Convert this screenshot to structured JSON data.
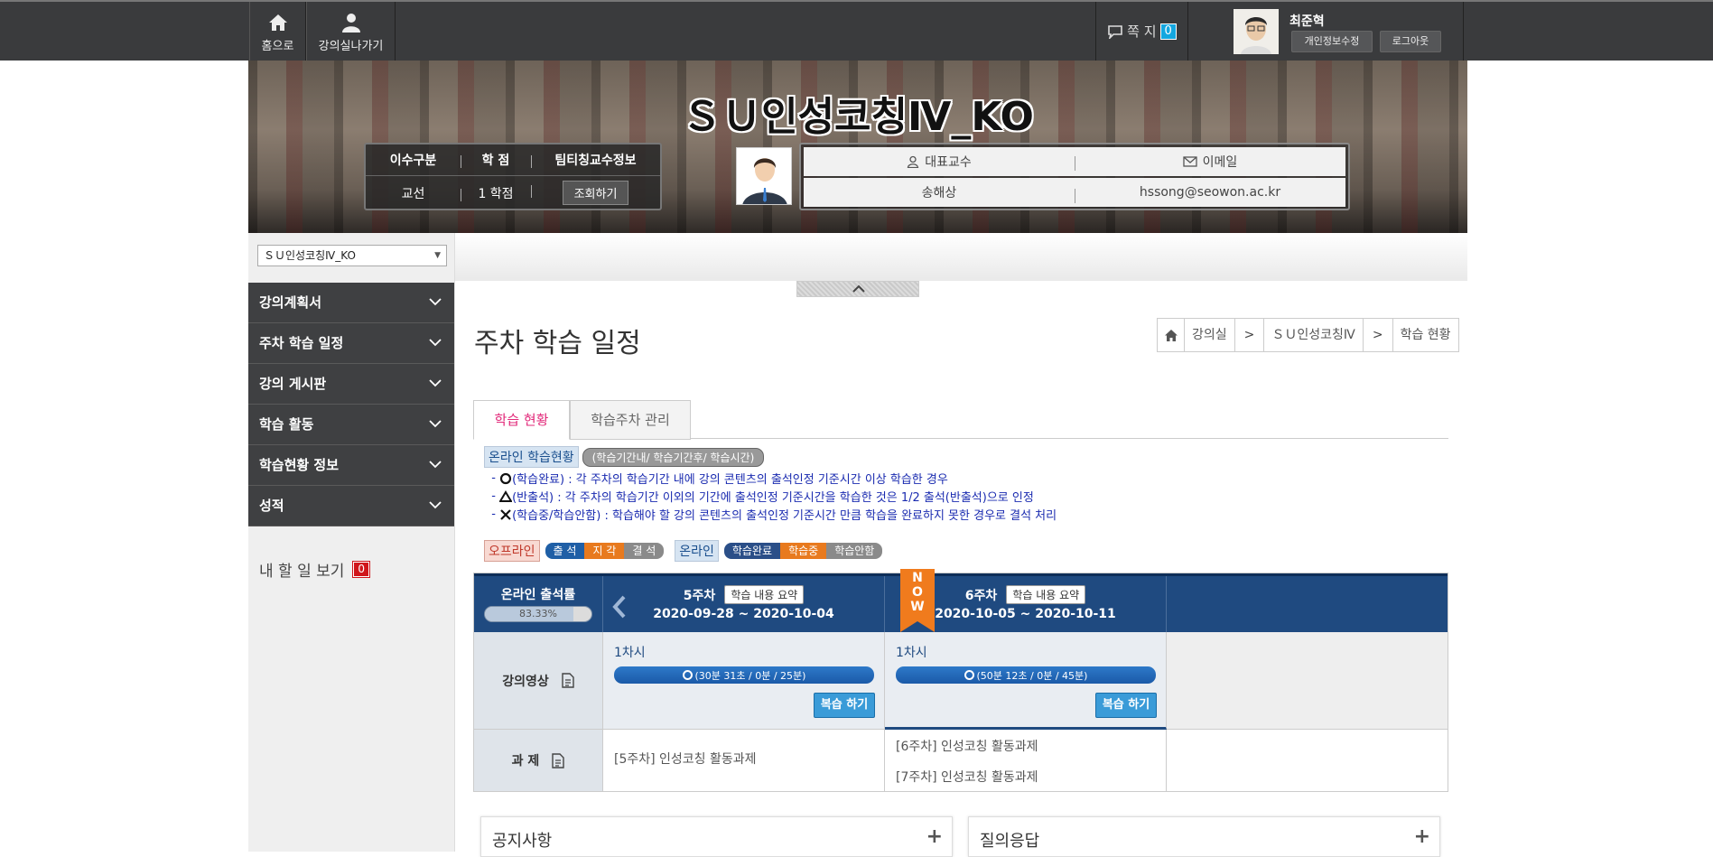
{
  "topbar": {
    "home_label": "홈으로",
    "exit_label": "강의실나가기",
    "message_label": "쪽 지",
    "message_count": "0",
    "user_name": "최준혁",
    "edit_profile": "개인정보수정",
    "logout": "로그아웃"
  },
  "banner": {
    "course_title": "ＳＵ인성코칭Ⅳ_KO",
    "headers": [
      "이수구분",
      "학 점",
      "팀티칭교수정보"
    ],
    "values": [
      "교선",
      "1 학점"
    ],
    "lookup_button": "조회하기",
    "prof_label": "대표교수",
    "email_label": "이메일",
    "prof_name": "송해상",
    "prof_email": "hssong@seowon.ac.kr"
  },
  "sidebar": {
    "course_select": "ＳＵ인성코칭Ⅳ_KO",
    "menu": [
      "강의계획서",
      "주차 학습 일정",
      "강의 게시판",
      "학습 활동",
      "학습현황 정보",
      "성적"
    ],
    "todo_label": "내 할 일 보기",
    "todo_count": "0"
  },
  "main": {
    "title": "주차 학습 일정",
    "breadcrumb": [
      "강의실",
      "ＳＵ인성코칭Ⅳ",
      "학습 현황"
    ],
    "tabs": [
      "학습 현황",
      "학습주차 관리"
    ],
    "legend": {
      "online_status": "온라인 학습현황",
      "period_note": "(학습기간내/ 학습기간후/ 학습시간)",
      "line1": "(학습완료) : 각 주차의 학습기간 내에 강의 콘텐츠의 출석인정 기준시간 이상 학습한 경우",
      "line2": "(반출석) : 각 주차의 학습기간 이외의 기간에 출석인정 기준시간을 학습한 것은 1/2 출석(반출석)으로 인정",
      "line3": "(학습중/학습안함) : 학습해야 할 강의 콘텐츠의 출석인정 기준시간 만큼 학습을 완료하지 못한 경우로 결석 처리",
      "offline": "오프라인",
      "offline_items": [
        "출 석",
        "지 각",
        "결 석"
      ],
      "online": "온라인",
      "online_items": [
        "학습완료",
        "학습중",
        "학습안함"
      ]
    },
    "schedule": {
      "rate_label": "온라인 출석률",
      "rate_text": "83.33%",
      "rate_value": 83.33,
      "summary_btn": "학습 내용 요약",
      "now_text": "NOW",
      "weeks": [
        {
          "name": "5주차",
          "dates": "2020-09-28 ~ 2020-10-04",
          "session": "1차시",
          "progress": "(30분 31초 / 0분 / 25분)",
          "review": "복습 하기",
          "tasks": [
            "[5주차] 인성코칭 활동과제"
          ]
        },
        {
          "name": "6주차",
          "dates": "2020-10-05 ~ 2020-10-11",
          "session": "1차시",
          "progress": "(50분 12초 / 0분 / 45분)",
          "review": "복습 하기",
          "tasks": [
            "[6주차] 인성코칭 활동과제",
            "[7주차] 인성코칭 활동과제"
          ]
        }
      ],
      "row_video": "강의영상",
      "row_task": "과 제"
    }
  },
  "panels": {
    "notice": "공지사항",
    "qna": "질의응답"
  },
  "colors": {
    "accent_pink": "#e22a7a",
    "header_navy": "#1f4a80",
    "progress_blue": "#1b5aa8",
    "todo_red": "#d0161b"
  }
}
